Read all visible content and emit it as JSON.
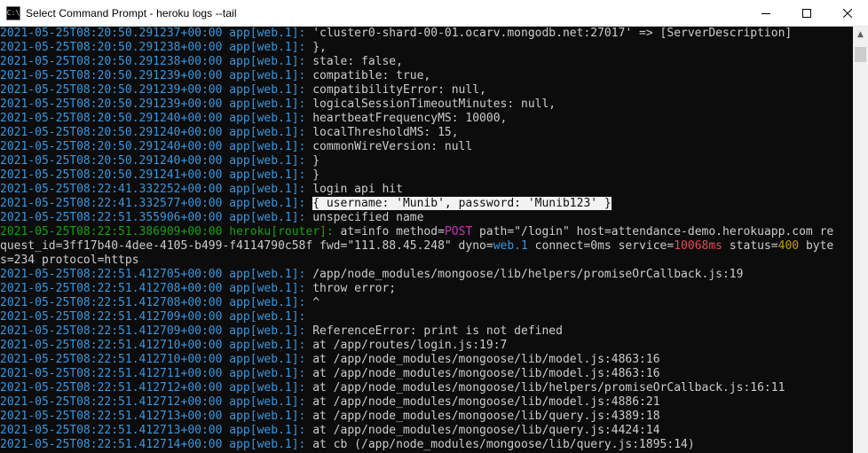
{
  "window": {
    "title": "Select Command Prompt - heroku  logs --tail",
    "icon_text": "C:\\",
    "minimize_icon": "minimize-icon",
    "maximize_icon": "maximize-icon",
    "close_icon": "close-icon"
  },
  "terminal": {
    "lines": [
      {
        "ts": "2021-05-25T08:20:50.291237+00:00",
        "src": "app[web.1]:",
        "msg": " 'cluster0-shard-00-01.ocarv.mongodb.net:27017' => [ServerDescription]"
      },
      {
        "ts": "2021-05-25T08:20:50.291238+00:00",
        "src": "app[web.1]:",
        "msg": " },"
      },
      {
        "ts": "2021-05-25T08:20:50.291238+00:00",
        "src": "app[web.1]:",
        "msg": " stale: false,"
      },
      {
        "ts": "2021-05-25T08:20:50.291239+00:00",
        "src": "app[web.1]:",
        "msg": " compatible: true,"
      },
      {
        "ts": "2021-05-25T08:20:50.291239+00:00",
        "src": "app[web.1]:",
        "msg": " compatibilityError: null,"
      },
      {
        "ts": "2021-05-25T08:20:50.291239+00:00",
        "src": "app[web.1]:",
        "msg": " logicalSessionTimeoutMinutes: null,"
      },
      {
        "ts": "2021-05-25T08:20:50.291240+00:00",
        "src": "app[web.1]:",
        "msg": " heartbeatFrequencyMS: 10000,"
      },
      {
        "ts": "2021-05-25T08:20:50.291240+00:00",
        "src": "app[web.1]:",
        "msg": " localThresholdMS: 15,"
      },
      {
        "ts": "2021-05-25T08:20:50.291240+00:00",
        "src": "app[web.1]:",
        "msg": " commonWireVersion: null"
      },
      {
        "ts": "2021-05-25T08:20:50.291240+00:00",
        "src": "app[web.1]:",
        "msg": " }"
      },
      {
        "ts": "2021-05-25T08:20:50.291241+00:00",
        "src": "app[web.1]:",
        "msg": " }"
      },
      {
        "ts": "2021-05-25T08:22:41.332252+00:00",
        "src": "app[web.1]:",
        "msg": " login api hit"
      }
    ],
    "selected_line": {
      "ts": "2021-05-25T08:22:41.332577+00:00",
      "src": "app[web.1]:",
      "pre": " ",
      "selected": "{ username: 'Munib', password: 'Munib123' }"
    },
    "line_after_selected": {
      "ts": "2021-05-25T08:22:51.355906+00:00",
      "src": "app[web.1]:",
      "msg": " unspecified name"
    },
    "router": {
      "ts": "2021-05-25T08:22:51.386909+00:00",
      "src": "heroku[router]:",
      "p1": " at=info method=",
      "method": "POST",
      "p2": " path=\"/login\" host=attendance-demo.herokuapp.com re",
      "p3": "quest_id=3ff17b40-4dee-4105-b499-f4114790c58f fwd=\"111.88.45.248\" dyno=",
      "dyno": "web.1",
      "p4": " connect=0ms service=",
      "service": "10068ms",
      "p5": " status=",
      "status": "400",
      "p6": " byte",
      "p7": "s=234 protocol=https"
    },
    "lines2": [
      {
        "ts": "2021-05-25T08:22:51.412705+00:00",
        "src": "app[web.1]:",
        "msg": " /app/node_modules/mongoose/lib/helpers/promiseOrCallback.js:19"
      },
      {
        "ts": "2021-05-25T08:22:51.412708+00:00",
        "src": "app[web.1]:",
        "msg": " throw error;"
      },
      {
        "ts": "2021-05-25T08:22:51.412708+00:00",
        "src": "app[web.1]:",
        "msg": " ^"
      },
      {
        "ts": "2021-05-25T08:22:51.412709+00:00",
        "src": "app[web.1]:",
        "msg": ""
      },
      {
        "ts": "2021-05-25T08:22:51.412709+00:00",
        "src": "app[web.1]:",
        "msg": " ReferenceError: print is not defined"
      },
      {
        "ts": "2021-05-25T08:22:51.412710+00:00",
        "src": "app[web.1]:",
        "msg": " at /app/routes/login.js:19:7"
      },
      {
        "ts": "2021-05-25T08:22:51.412710+00:00",
        "src": "app[web.1]:",
        "msg": " at /app/node_modules/mongoose/lib/model.js:4863:16"
      },
      {
        "ts": "2021-05-25T08:22:51.412711+00:00",
        "src": "app[web.1]:",
        "msg": " at /app/node_modules/mongoose/lib/model.js:4863:16"
      },
      {
        "ts": "2021-05-25T08:22:51.412712+00:00",
        "src": "app[web.1]:",
        "msg": " at /app/node_modules/mongoose/lib/helpers/promiseOrCallback.js:16:11"
      },
      {
        "ts": "2021-05-25T08:22:51.412712+00:00",
        "src": "app[web.1]:",
        "msg": " at /app/node_modules/mongoose/lib/model.js:4886:21"
      },
      {
        "ts": "2021-05-25T08:22:51.412713+00:00",
        "src": "app[web.1]:",
        "msg": " at /app/node_modules/mongoose/lib/query.js:4389:18"
      },
      {
        "ts": "2021-05-25T08:22:51.412713+00:00",
        "src": "app[web.1]:",
        "msg": " at /app/node_modules/mongoose/lib/query.js:4424:14"
      },
      {
        "ts": "2021-05-25T08:22:51.412714+00:00",
        "src": "app[web.1]:",
        "msg": " at cb (/app/node_modules/mongoose/lib/query.js:1895:14)"
      }
    ]
  },
  "colors": {
    "background": "#0c0c0c",
    "foreground": "#cccccc",
    "timestamp_blue": "#3a96dd",
    "router_green": "#13a10e",
    "magenta": "#c239b3",
    "red": "#e74856",
    "yellow": "#c19c00"
  }
}
